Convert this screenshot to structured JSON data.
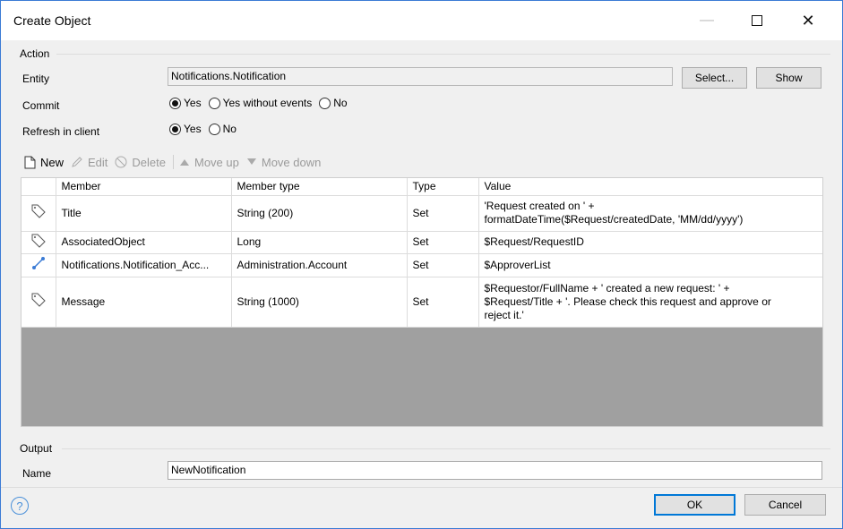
{
  "window": {
    "title": "Create Object",
    "minimize_glyph": "—",
    "close_glyph": "✕"
  },
  "action": {
    "section_label": "Action",
    "entity": {
      "label": "Entity",
      "value": "Notifications.Notification",
      "select_button": "Select...",
      "show_button": "Show"
    },
    "commit": {
      "label": "Commit",
      "options": [
        "Yes",
        "Yes without events",
        "No"
      ],
      "selected": "Yes"
    },
    "refresh": {
      "label": "Refresh in client",
      "options": [
        "Yes",
        "No"
      ],
      "selected": "Yes"
    }
  },
  "toolbar": {
    "new": "New",
    "edit": "Edit",
    "delete": "Delete",
    "move_up": "Move up",
    "move_down": "Move down"
  },
  "members_table": {
    "columns": [
      "Member",
      "Member type",
      "Type",
      "Value"
    ],
    "rows": [
      {
        "icon": "attribute-tag-icon",
        "member": "Title",
        "member_type": "String (200)",
        "type": "Set",
        "value": "'Request created on ' +\nformatDateTime($Request/createdDate, 'MM/dd/yyyy')"
      },
      {
        "icon": "attribute-tag-icon",
        "member": "AssociatedObject",
        "member_type": "Long",
        "type": "Set",
        "value": "$Request/RequestID"
      },
      {
        "icon": "association-icon",
        "member": "Notifications.Notification_Acc...",
        "member_type": "Administration.Account",
        "type": "Set",
        "value": "$ApproverList"
      },
      {
        "icon": "attribute-tag-icon",
        "member": "Message",
        "member_type": "String (1000)",
        "type": "Set",
        "value": "$Requestor/FullName + ' created a new request: ' +\n$Request/Title + '. Please check this request and approve or\nreject it.'"
      }
    ]
  },
  "output": {
    "section_label": "Output",
    "name_label": "Name",
    "name_value": "NewNotification"
  },
  "footer": {
    "help_glyph": "?",
    "ok": "OK",
    "cancel": "Cancel"
  },
  "colors": {
    "accent": "#0078d7",
    "grid_empty": "#a0a0a0",
    "help": "#4a90d9"
  }
}
